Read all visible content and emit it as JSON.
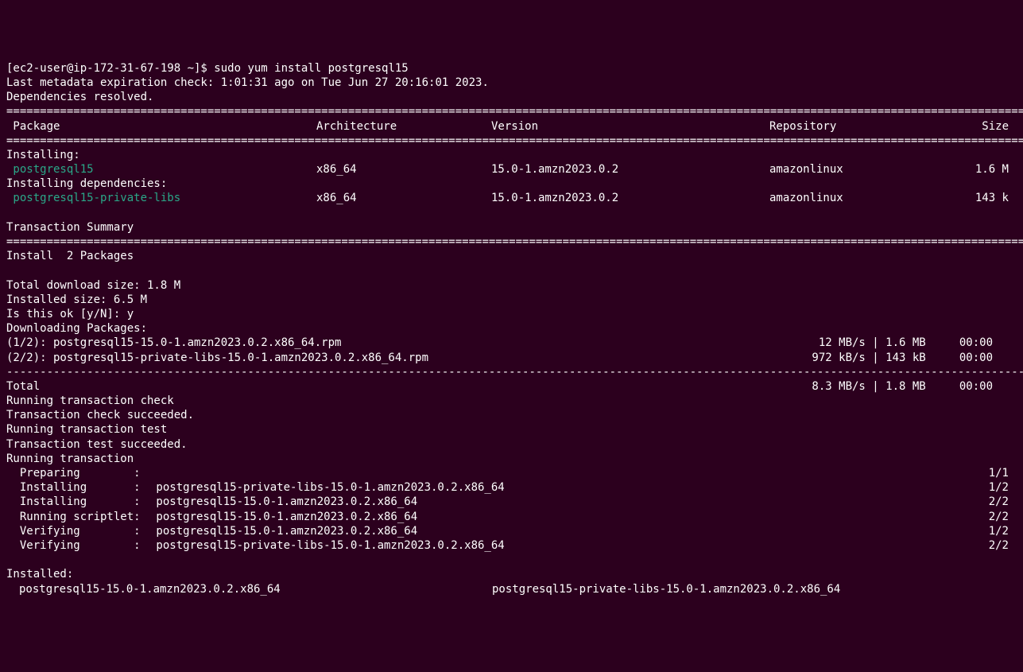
{
  "prompt": "[ec2-user@ip-172-31-67-198 ~]$ ",
  "command": "sudo yum install postgresql15",
  "meta_line": "Last metadata expiration check: 1:01:31 ago on Tue Jun 27 20:16:01 2023.",
  "deps_line": "Dependencies resolved.",
  "rule_double": "===========================================================================================================================================================",
  "rule_dash": "-----------------------------------------------------------------------------------------------------------------------------------------------------------",
  "headers": {
    "pkg": " Package",
    "arch": "Architecture",
    "ver": "Version",
    "repo": "Repository",
    "size": "Size"
  },
  "installing_label": "Installing:",
  "installing_deps_label": "Installing dependencies:",
  "packages": [
    {
      "name": " postgresql15",
      "arch": "x86_64",
      "ver": "15.0-1.amzn2023.0.2",
      "repo": "amazonlinux",
      "size": "1.6 M"
    }
  ],
  "dep_packages": [
    {
      "name": " postgresql15-private-libs",
      "arch": "x86_64",
      "ver": "15.0-1.amzn2023.0.2",
      "repo": "amazonlinux",
      "size": "143 k"
    }
  ],
  "tx_summary_label": "Transaction Summary",
  "install_count": "Install  2 Packages",
  "total_dl": "Total download size: 1.8 M",
  "installed_size": "Installed size: 6.5 M",
  "confirm": "Is this ok [y/N]: y",
  "downloading": "Downloading Packages:",
  "downloads": [
    {
      "left": "(1/2): postgresql15-15.0-1.amzn2023.0.2.x86_64.rpm",
      "right": " 12 MB/s | 1.6 MB     00:00"
    },
    {
      "left": "(2/2): postgresql15-private-libs-15.0-1.amzn2023.0.2.x86_64.rpm",
      "right": "972 kB/s | 143 kB     00:00"
    }
  ],
  "total_line": {
    "left": "Total",
    "right": "8.3 MB/s | 1.8 MB     00:00"
  },
  "tx_lines_pre": [
    "Running transaction check",
    "Transaction check succeeded.",
    "Running transaction test",
    "Transaction test succeeded.",
    "Running transaction"
  ],
  "tx_steps": [
    {
      "act": "  Preparing        :",
      "pkg": "",
      "num": "1/1"
    },
    {
      "act": "  Installing       :",
      "pkg": " postgresql15-private-libs-15.0-1.amzn2023.0.2.x86_64",
      "num": "1/2"
    },
    {
      "act": "  Installing       :",
      "pkg": " postgresql15-15.0-1.amzn2023.0.2.x86_64",
      "num": "2/2"
    },
    {
      "act": "  Running scriptlet:",
      "pkg": " postgresql15-15.0-1.amzn2023.0.2.x86_64",
      "num": "2/2"
    },
    {
      "act": "  Verifying        :",
      "pkg": " postgresql15-15.0-1.amzn2023.0.2.x86_64",
      "num": "1/2"
    },
    {
      "act": "  Verifying        :",
      "pkg": " postgresql15-private-libs-15.0-1.amzn2023.0.2.x86_64",
      "num": "2/2"
    }
  ],
  "installed_label": "Installed:",
  "installed": [
    "postgresql15-15.0-1.amzn2023.0.2.x86_64",
    "postgresql15-private-libs-15.0-1.amzn2023.0.2.x86_64"
  ]
}
